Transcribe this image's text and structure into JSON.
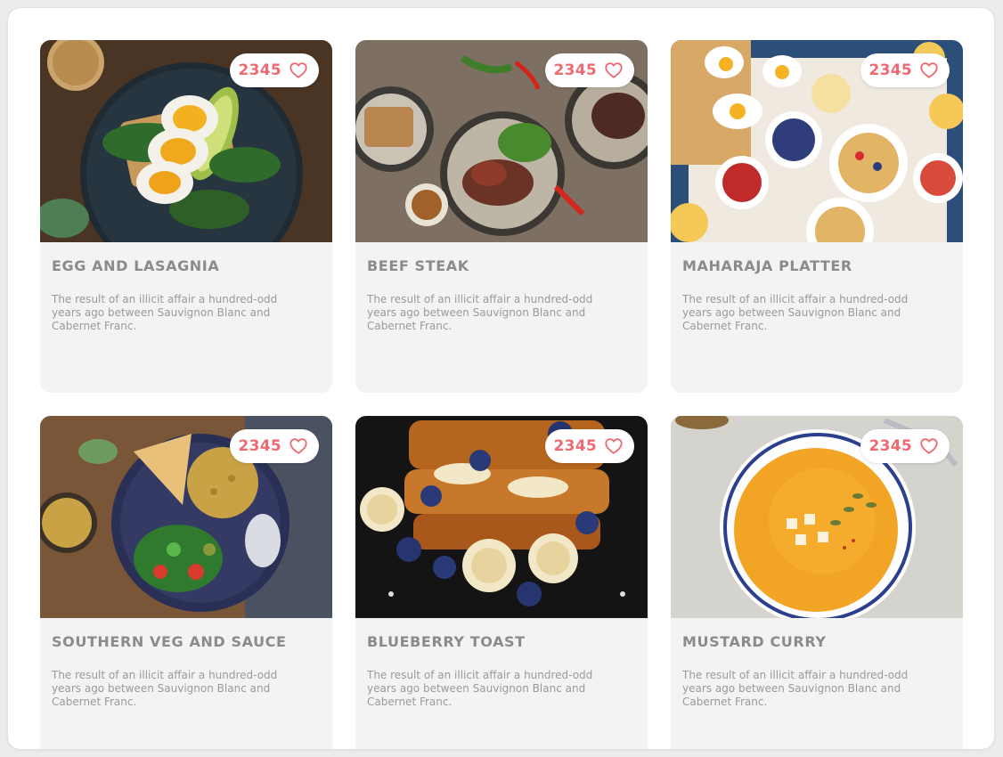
{
  "cards": [
    {
      "title": "EGG AND LASAGNIA",
      "likes": "2345",
      "description": "The result of an illicit affair a hundred-odd years ago between Sauvignon Blanc and Cabernet Franc.",
      "image": "egg-avocado-toast-photo"
    },
    {
      "title": "BEEF STEAK",
      "likes": "2345",
      "description": "The result of an illicit affair a hundred-odd years ago between Sauvignon Blanc and Cabernet Franc.",
      "image": "beef-steak-plates-photo"
    },
    {
      "title": "MAHARAJA PLATTER",
      "likes": "2345",
      "description": "The result of an illicit affair a hundred-odd years ago between Sauvignon Blanc and Cabernet Franc.",
      "image": "breakfast-platter-photo"
    },
    {
      "title": "SOUTHERN VEG AND SAUCE",
      "likes": "2345",
      "description": "The result of an illicit affair a hundred-odd years ago between Sauvignon Blanc and Cabernet Franc.",
      "image": "veg-bowl-chickpeas-photo"
    },
    {
      "title": "BLUEBERRY TOAST",
      "likes": "2345",
      "description": "The result of an illicit affair a hundred-odd years ago between Sauvignon Blanc and Cabernet Franc.",
      "image": "french-toast-blueberry-photo"
    },
    {
      "title": "MUSTARD CURRY",
      "likes": "2345",
      "description": "The result of an illicit affair a hundred-odd years ago between Sauvignon Blanc and Cabernet Franc.",
      "image": "orange-soup-bowl-photo"
    }
  ],
  "colors": {
    "accent": "#ec6b73",
    "card_bg": "#f3f3f4",
    "title": "#8b8b8b",
    "text": "#9a9a9a"
  },
  "icons": {
    "like": "heart-outline-icon"
  }
}
